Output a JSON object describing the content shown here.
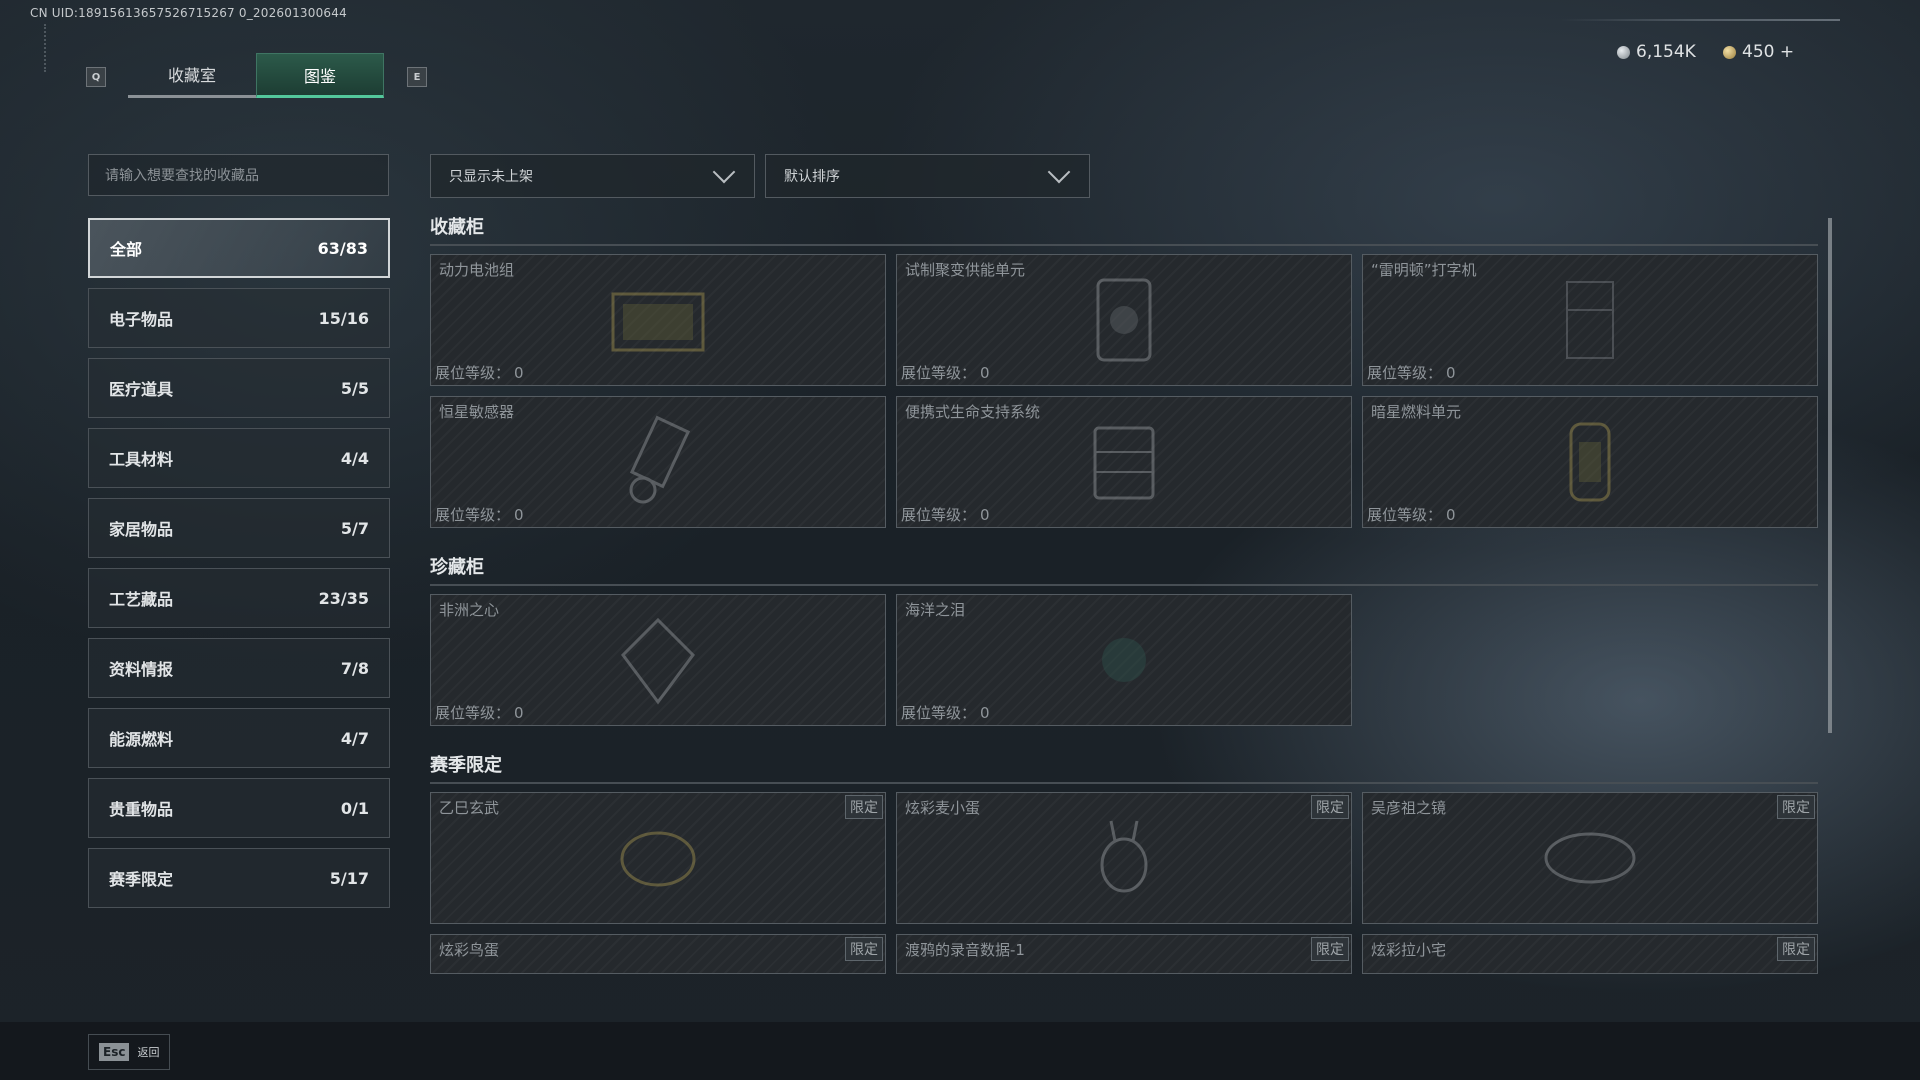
{
  "header": {
    "uid": "CN UID:18915613657526715267 0_202601300644",
    "tabs": [
      {
        "label": "收藏室",
        "key": "Q"
      },
      {
        "label": "图鉴",
        "key": "E"
      }
    ],
    "currency": [
      {
        "icon": "silver-coin-icon",
        "value": "6,154K"
      },
      {
        "icon": "gold-coin-icon",
        "value": "450 +"
      }
    ]
  },
  "search": {
    "placeholder": "请输入想要查找的收藏品"
  },
  "filters": [
    {
      "label": "只显示未上架"
    },
    {
      "label": "默认排序"
    }
  ],
  "categories": [
    {
      "label": "全部",
      "count": "63/83"
    },
    {
      "label": "电子物品",
      "count": "15/16"
    },
    {
      "label": "医疗道具",
      "count": "5/5"
    },
    {
      "label": "工具材料",
      "count": "4/4"
    },
    {
      "label": "家居物品",
      "count": "5/7"
    },
    {
      "label": "工艺藏品",
      "count": "23/35"
    },
    {
      "label": "资料情报",
      "count": "7/8"
    },
    {
      "label": "能源燃料",
      "count": "4/7"
    },
    {
      "label": "贵重物品",
      "count": "0/1"
    },
    {
      "label": "赛季限定",
      "count": "5/17"
    }
  ],
  "sections": [
    {
      "title": "收藏柜",
      "items": [
        {
          "name": "动力电池组",
          "level_label": "展位等级：",
          "level": "0"
        },
        {
          "name": "试制聚变供能单元",
          "level_label": "展位等级：",
          "level": "0"
        },
        {
          "name": "“雷明顿”打字机",
          "level_label": "展位等级：",
          "level": "0"
        },
        {
          "name": "恒星敏感器",
          "level_label": "展位等级：",
          "level": "0"
        },
        {
          "name": "便携式生命支持系统",
          "level_label": "展位等级：",
          "level": "0"
        },
        {
          "name": "暗星燃料单元",
          "level_label": "展位等级：",
          "level": "0"
        }
      ]
    },
    {
      "title": "珍藏柜",
      "items": [
        {
          "name": "非洲之心",
          "level_label": "展位等级：",
          "level": "0"
        },
        {
          "name": "海洋之泪",
          "level_label": "展位等级：",
          "level": "0"
        }
      ]
    },
    {
      "title": "赛季限定",
      "items": [
        {
          "name": "乙巳玄武",
          "tag": "限定"
        },
        {
          "name": "炫彩麦小蛋",
          "tag": "限定"
        },
        {
          "name": "吴彦祖之镜",
          "tag": "限定"
        },
        {
          "name": "炫彩鸟蛋",
          "tag": "限定"
        },
        {
          "name": "渡鸦的录音数据-1",
          "tag": "限定"
        },
        {
          "name": "炫彩拉小宅",
          "tag": "限定"
        }
      ]
    }
  ],
  "footer": {
    "esc_key": "Esc",
    "back_label": "返回"
  }
}
